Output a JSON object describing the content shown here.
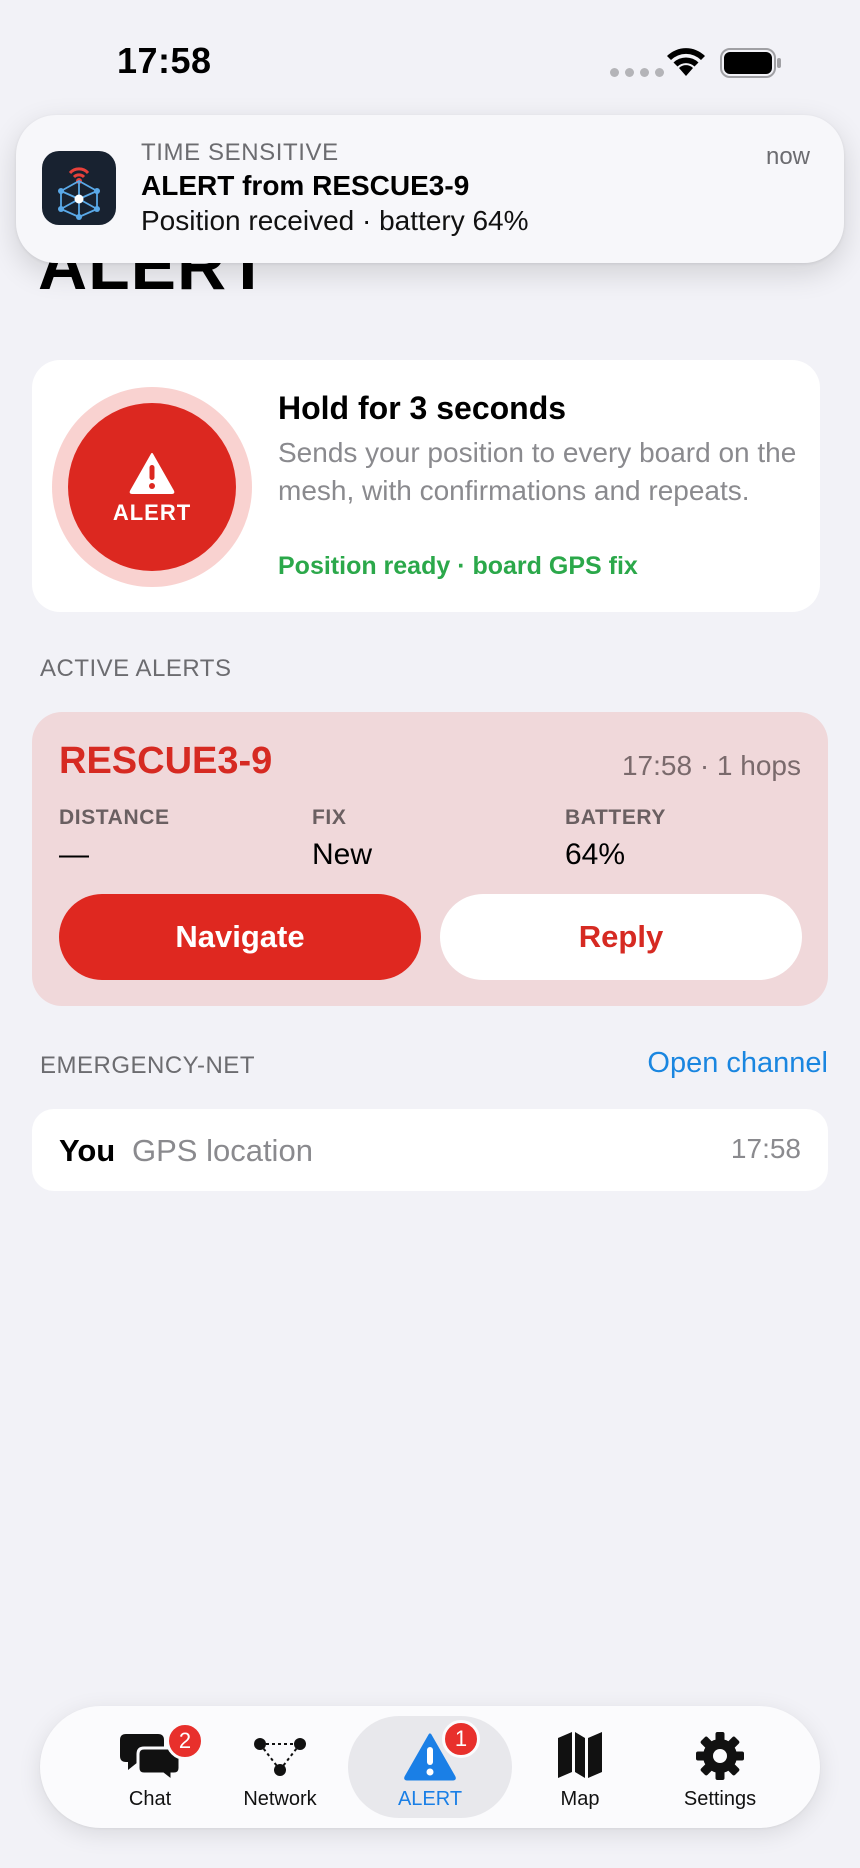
{
  "status_bar": {
    "time": "17:58"
  },
  "page": {
    "title": "ALERT"
  },
  "notification": {
    "label": "TIME SENSITIVE",
    "title": "ALERT from RESCUE3-9",
    "body": "Position received · battery 64%",
    "time": "now"
  },
  "hold_card": {
    "button_label": "ALERT",
    "title": "Hold for 3 seconds",
    "description": "Sends your position to every board on the mesh, with confirmations and repeats.",
    "status": "Position ready · board GPS fix"
  },
  "active_alerts": {
    "header": "ACTIVE ALERTS",
    "items": [
      {
        "sender": "RESCUE3-9",
        "meta": "17:58 · 1 hops",
        "stats": [
          {
            "label": "DISTANCE",
            "value": "—"
          },
          {
            "label": "FIX",
            "value": "New"
          },
          {
            "label": "BATTERY",
            "value": "64%"
          }
        ],
        "navigate_label": "Navigate",
        "reply_label": "Reply"
      }
    ]
  },
  "channel": {
    "header": "EMERGENCY-NET",
    "open_label": "Open channel",
    "messages": [
      {
        "sender": "You",
        "text": "GPS location",
        "time": "17:58"
      }
    ]
  },
  "tab_bar": {
    "tabs": [
      {
        "label": "Chat",
        "icon": "chat-bubbles-icon",
        "badge": "2"
      },
      {
        "label": "Network",
        "icon": "network-nodes-icon"
      },
      {
        "label": "ALERT",
        "icon": "warning-triangle-icon",
        "badge": "1",
        "active": true
      },
      {
        "label": "Map",
        "icon": "map-icon"
      },
      {
        "label": "Settings",
        "icon": "gear-icon"
      }
    ]
  },
  "colors": {
    "alert_red": "#dc2820",
    "alert_card_bg": "#f0d8da",
    "link_blue": "#1a86e0",
    "ready_green": "#2ba84a",
    "active_tab_blue": "#1a7fe6"
  }
}
